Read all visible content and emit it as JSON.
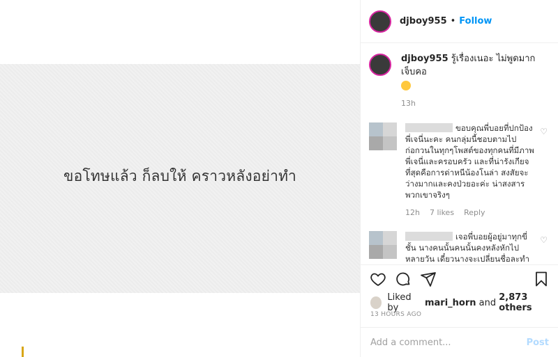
{
  "post": {
    "image_text": "ขอโทษแล้ว ก็ลบให้ คราวหลังอย่าทำ"
  },
  "header": {
    "username": "djboy955",
    "separator": "•",
    "follow_label": "Follow"
  },
  "caption": {
    "username": "djboy955",
    "text": "รู้เรื่องเนอะ ไม่พูดมาก เจ็บคอ",
    "time": "13h"
  },
  "comments": [
    {
      "text": "ขอบคุณพี่บอยที่ปกป้องพี่เจนี่นะคะ คนกลุ่มนี้ชอบตามไปก่อกวนในทุกๆโพสต์ของทุกคนที่มีภาพพี่เจนี่และครอบครัว และที่น่ารังเกียจที่สุดคือการด่าหนีน้องโนล่า สงสัยจะว่างมากและคงป่วยอะค่ะ น่าสงสารพวกเขาจริงๆ",
      "time": "12h",
      "likes": "7 likes",
      "reply": "Reply"
    },
    {
      "text": "เจอพี่บอยผู้อยู่มาทุกขี่ชั้น นางคนนั้นคนนั้นคงหลังหักไปหลายวัน เดี๋ยวนางจะเปลี่ยนชื่อละทำอีกคน แบบนี้ไม่มีวันปล่อยเจ้ ทำอีกพี่บอยยุ"
    }
  ],
  "likes": {
    "prefix": "Liked by",
    "user": "mari_horn",
    "and": "and",
    "count": "2,873 others"
  },
  "time_ago": "13 HOURS AGO",
  "comment_input": {
    "placeholder": "Add a comment...",
    "post_label": "Post"
  }
}
